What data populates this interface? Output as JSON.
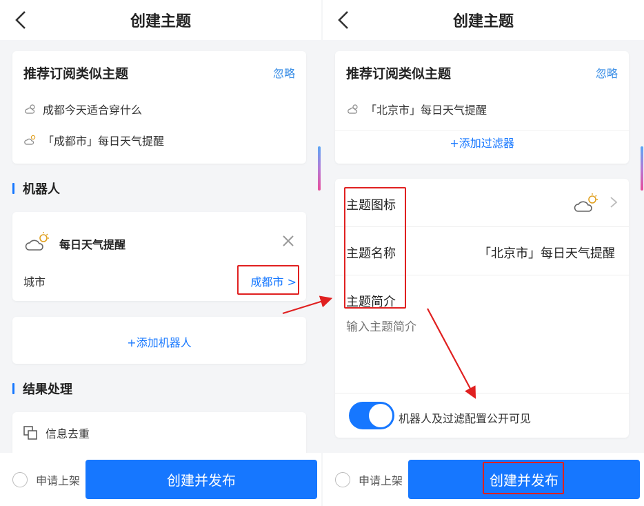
{
  "left": {
    "title": "创建主题",
    "recommend": {
      "title": "推荐订阅类似主题",
      "ignore": "忽略",
      "items": [
        {
          "text": "成都今天适合穿什么",
          "icon": "weather-small-icon"
        },
        {
          "text": "「成都市」每日天气提醒",
          "icon": "partly-cloudy-icon"
        }
      ]
    },
    "robot_section": "机器人",
    "robot": {
      "name": "每日天气提醒",
      "city_label": "城市",
      "city_value": "成都市 >"
    },
    "add_robot": "+添加机器人",
    "result_section": "结果处理",
    "dedup": "信息去重",
    "apply": "申请上架",
    "publish": "创建并发布"
  },
  "right": {
    "title": "创建主题",
    "recommend": {
      "title": "推荐订阅类似主题",
      "ignore": "忽略",
      "items": [
        {
          "text": "「北京市」每日天气提醒",
          "icon": "weather-small-icon"
        }
      ]
    },
    "add_filter": "+添加过滤器",
    "topic_icon_label": "主题图标",
    "topic_name_label": "主题名称",
    "topic_name_value": "「北京市」每日天气提醒",
    "topic_intro_label": "主题简介",
    "intro_placeholder": "输入主题简介",
    "public_toggle_label": "机器人及过滤配置公开可见",
    "apply": "申请上架",
    "publish": "创建并发布"
  },
  "colors": {
    "accent": "#1677ff",
    "highlight": "#e02020",
    "background": "#f4f5f7"
  }
}
